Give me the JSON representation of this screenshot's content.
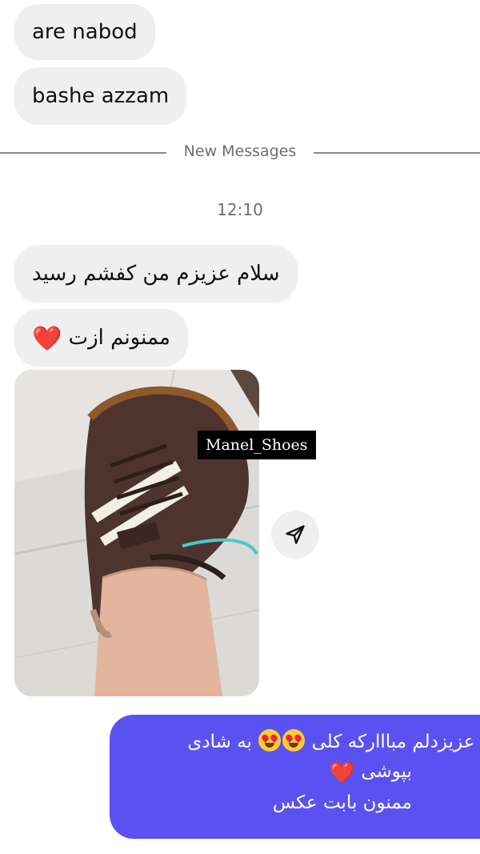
{
  "messages": {
    "incoming_1": "are nabod",
    "incoming_2": "bashe azzam",
    "incoming_3": "سلام عزیزم من کفشم رسید",
    "incoming_4": "ممنونم ازت",
    "incoming_4_heart": "❤️",
    "image_watermark": "Manel_Shoes",
    "outgoing_line1_a": "م عزیزدلم مبااارکه کلی",
    "outgoing_line1_b": "به شادی",
    "outgoing_line2": "بپوشی",
    "outgoing_line2_heart": "❤️",
    "outgoing_line3": "ممنون بابت عکس"
  },
  "divider": {
    "label": "New Messages"
  },
  "timestamp": "12:10",
  "icons": {
    "share": "send-icon",
    "emoji": "heart-eyes-emoji-icon",
    "heart": "red-heart-icon"
  },
  "colors": {
    "incoming_bubble": "#efefef",
    "outgoing_bubble": "#5a52f0",
    "secondary_text": "#6e6e6e"
  }
}
